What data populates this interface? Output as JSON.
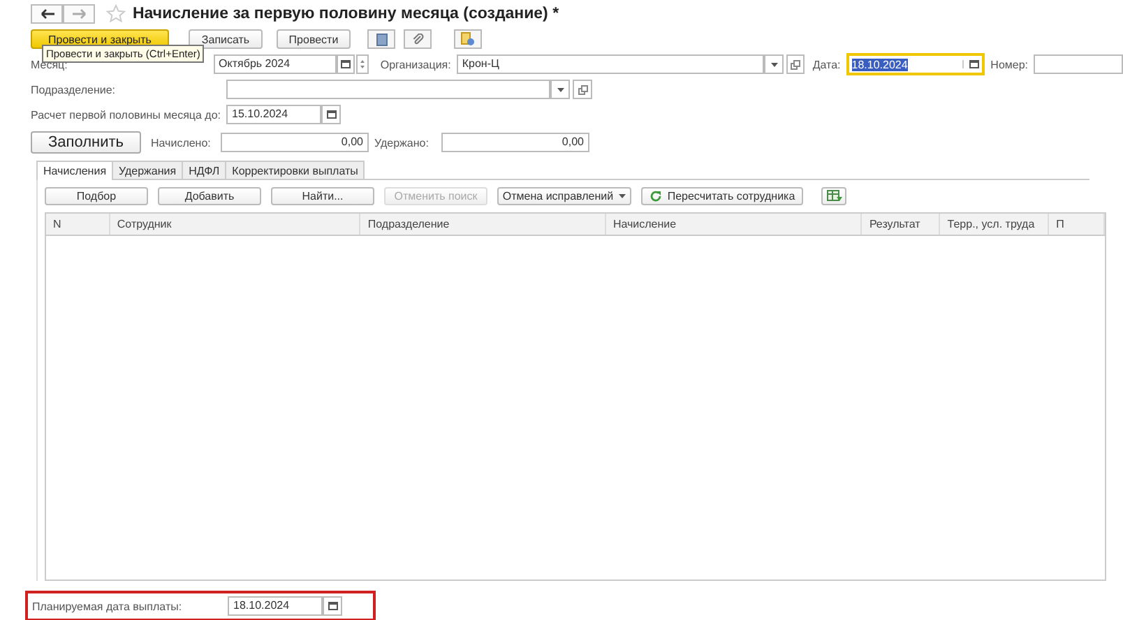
{
  "title": "Начисление за первую половину месяца (создание) *",
  "commands": [
    {
      "label": "Провести и закрыть",
      "kind": "primary"
    },
    {
      "label": "Записать",
      "kind": "plain"
    },
    {
      "label": "Провести",
      "kind": "plain"
    }
  ],
  "tooltip": "Провести и закрыть (Ctrl+Enter)",
  "month": {
    "label": "Месяц:",
    "value": "Октябрь 2024"
  },
  "organization": {
    "label": "Организация:",
    "value": "Крон-Ц"
  },
  "date": {
    "label": "Дата:",
    "value": "18.10.2024",
    "focused": true
  },
  "number": {
    "label": "Номер:"
  },
  "department": {
    "label": "Подразделение:"
  },
  "calc_until": {
    "label": "Расчет первой половины месяца до:",
    "value": "15.10.2024"
  },
  "fill_button": "Заполнить",
  "accrued": {
    "label": "Начислено:",
    "value": "0,00"
  },
  "withheld": {
    "label": "Удержано:",
    "value": "0,00"
  },
  "tabs": [
    {
      "label": "Начисления",
      "selected": true
    },
    {
      "label": "Удержания",
      "selected": false
    },
    {
      "label": "НДФЛ",
      "selected": false
    },
    {
      "label": "Корректировки выплаты",
      "selected": false
    }
  ],
  "toolbar": [
    {
      "label": "Подбор",
      "disabled": false,
      "kind": "plain"
    },
    {
      "label": "Добавить",
      "disabled": false,
      "kind": "plain"
    },
    {
      "label": "Найти...",
      "disabled": false,
      "kind": "plain"
    },
    {
      "label": "Отменить поиск",
      "disabled": true,
      "kind": "plain"
    },
    {
      "label": "Отмена исправлений",
      "disabled": false,
      "kind": "menu"
    },
    {
      "label": "Пересчитать сотрудника",
      "disabled": false,
      "kind": "refresh"
    }
  ],
  "table": {
    "columns": [
      "N",
      "Сотрудник",
      "Подразделение",
      "Начисление",
      "Результат",
      "Терр., усл. труда",
      "П"
    ]
  },
  "payment_date": {
    "label": "Планируемая дата выплаты:",
    "value": "18.10.2024"
  }
}
